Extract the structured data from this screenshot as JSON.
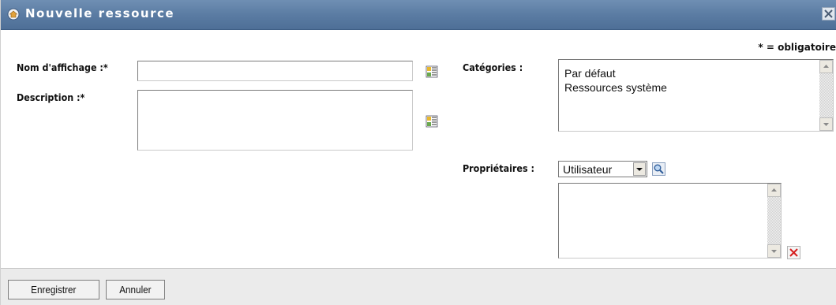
{
  "window": {
    "title": "Nouvelle ressource",
    "title_icon": "resource-icon",
    "close_icon": "close-icon"
  },
  "form": {
    "required_note": "* = obligatoire",
    "display_name": {
      "label": "Nom d'affichage :*",
      "value": "",
      "icon": "language-icon"
    },
    "description": {
      "label": "Description :*",
      "value": "",
      "icon": "language-icon"
    },
    "categories": {
      "label": "Catégories :",
      "items": [
        "Par défaut",
        "Ressources système"
      ]
    },
    "owners": {
      "label": "Propriétaires :",
      "type_selected": "Utilisateur",
      "search_icon": "search-icon",
      "delete_icon": "delete-icon",
      "items": []
    }
  },
  "footer": {
    "save_label": "Enregistrer",
    "cancel_label": "Annuler"
  },
  "colors": {
    "titlebar": "#5b7ca3",
    "footer": "#ebebeb",
    "delete_red": "#d61f1f"
  }
}
